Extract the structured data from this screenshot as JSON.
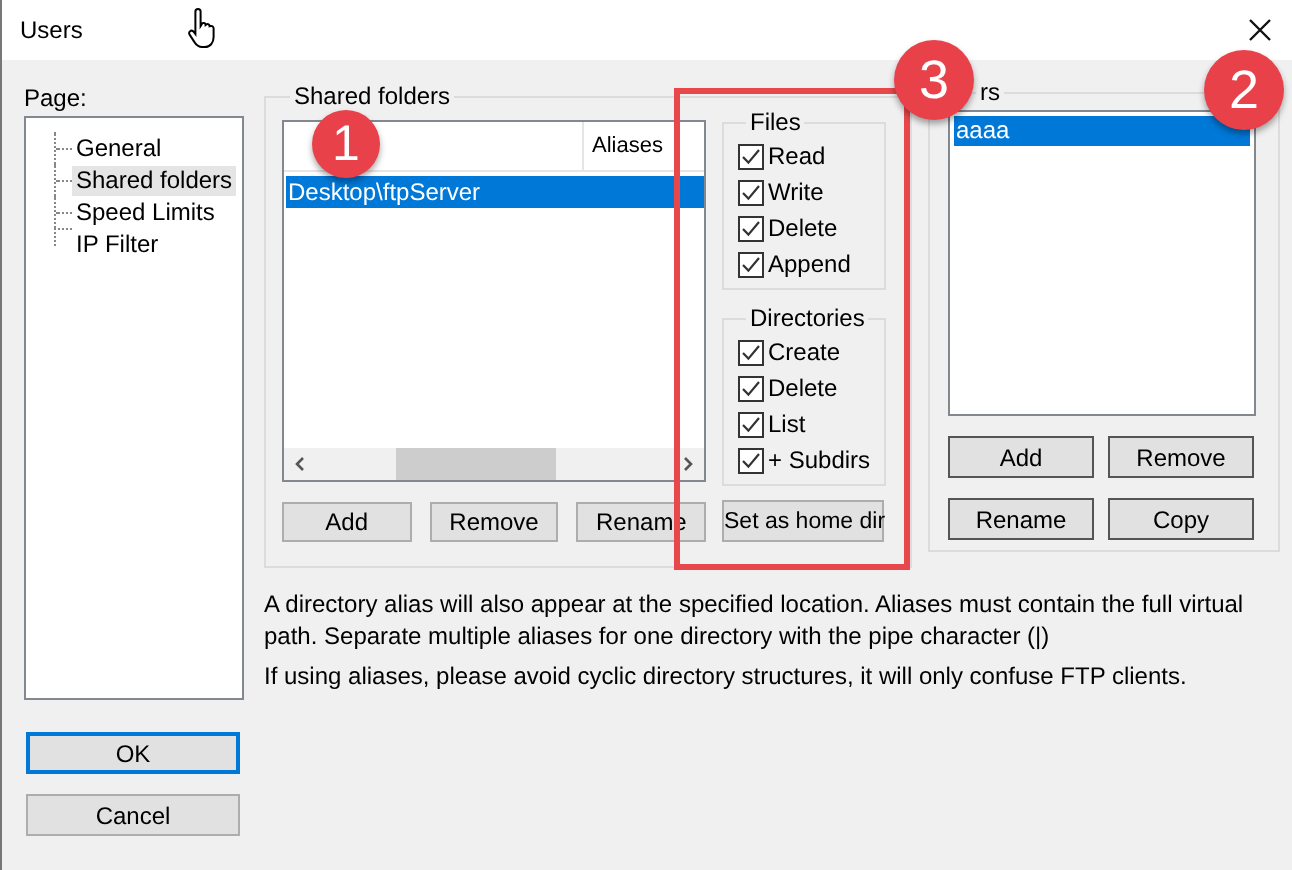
{
  "window": {
    "title": "Users"
  },
  "page_label": "Page:",
  "tree": {
    "items": [
      {
        "label": "General",
        "selected": false
      },
      {
        "label": "Shared folders",
        "selected": true
      },
      {
        "label": "Speed Limits",
        "selected": false
      },
      {
        "label": "IP Filter",
        "selected": false
      }
    ]
  },
  "shared_folders": {
    "title": "Shared folders",
    "aliases_column": "Aliases",
    "rows": [
      {
        "directory": "Desktop\\ftpServer",
        "selected": true
      }
    ],
    "buttons": [
      "Add",
      "Remove",
      "Rename"
    ],
    "files": {
      "title": "Files",
      "options": [
        {
          "label": "Read",
          "checked": true
        },
        {
          "label": "Write",
          "checked": true
        },
        {
          "label": "Delete",
          "checked": true
        },
        {
          "label": "Append",
          "checked": true
        }
      ]
    },
    "directories": {
      "title": "Directories",
      "options": [
        {
          "label": "Create",
          "checked": true
        },
        {
          "label": "Delete",
          "checked": true
        },
        {
          "label": "List",
          "checked": true
        },
        {
          "label": "+ Subdirs",
          "checked": true
        }
      ]
    },
    "home_button": "Set as home dir"
  },
  "users": {
    "title": "rs",
    "items": [
      {
        "label": "aaaa",
        "selected": true
      }
    ],
    "buttons": [
      "Add",
      "Remove",
      "Rename",
      "Copy"
    ]
  },
  "notes": [
    "A directory alias will also appear at the specified location. Aliases must contain the full virtual path. Separate multiple aliases for one directory with the pipe character (|)",
    "If using aliases, please avoid cyclic directory structures, it will only confuse FTP clients."
  ],
  "dialog_buttons": [
    {
      "label": "OK",
      "default": true
    },
    {
      "label": "Cancel",
      "default": false
    }
  ],
  "annotations": [
    {
      "label": "1"
    },
    {
      "label": "3"
    },
    {
      "label": "2"
    }
  ]
}
